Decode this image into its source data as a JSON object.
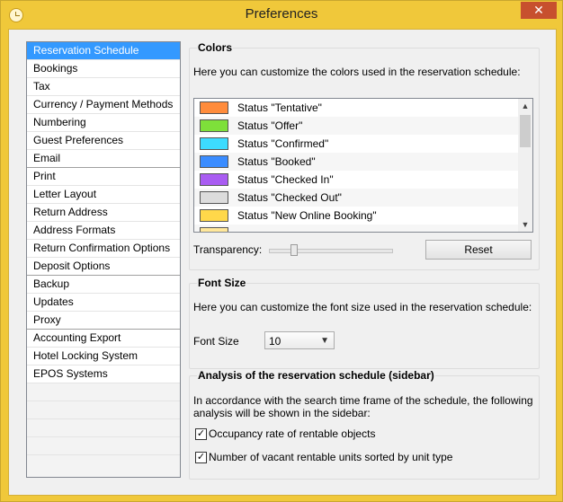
{
  "window": {
    "title": "Preferences",
    "close_symbol": "✕"
  },
  "sidebar": {
    "items": [
      {
        "label": "Reservation Schedule",
        "selected": true,
        "group_end": false
      },
      {
        "label": "Bookings",
        "group_end": false
      },
      {
        "label": "Tax",
        "group_end": false
      },
      {
        "label": "Currency / Payment Methods",
        "group_end": false
      },
      {
        "label": "Numbering",
        "group_end": false
      },
      {
        "label": "Guest Preferences",
        "group_end": false
      },
      {
        "label": "Email",
        "group_end": true
      },
      {
        "label": "Print",
        "group_end": false
      },
      {
        "label": "Letter Layout",
        "group_end": false
      },
      {
        "label": "Return Address",
        "group_end": false
      },
      {
        "label": "Address Formats",
        "group_end": false
      },
      {
        "label": "Return Confirmation Options",
        "group_end": false
      },
      {
        "label": "Deposit Options",
        "group_end": true
      },
      {
        "label": "Backup",
        "group_end": false
      },
      {
        "label": "Updates",
        "group_end": false
      },
      {
        "label": "Proxy",
        "group_end": true
      },
      {
        "label": "Accounting Export",
        "group_end": false
      },
      {
        "label": "Hotel Locking System",
        "group_end": false
      },
      {
        "label": "EPOS Systems",
        "group_end": false
      }
    ]
  },
  "colors": {
    "title": "Colors",
    "description": "Here you can customize the colors used in the reservation schedule:",
    "statuses": [
      {
        "label": "Status \"Tentative\"",
        "color": "#ff8c3c"
      },
      {
        "label": "Status \"Offer\"",
        "color": "#7ee03a"
      },
      {
        "label": "Status \"Confirmed\"",
        "color": "#3ddcff"
      },
      {
        "label": "Status \"Booked\"",
        "color": "#3a8cff"
      },
      {
        "label": "Status \"Checked In\"",
        "color": "#a95cf2"
      },
      {
        "label": "Status \"Checked Out\"",
        "color": "#dcdcdc"
      },
      {
        "label": "Status \"New Online Booking\"",
        "color": "#ffd84a"
      }
    ],
    "transparency_label": "Transparency:",
    "transparency_value": 0.2,
    "reset_label": "Reset"
  },
  "font_size": {
    "title": "Font Size",
    "description": "Here you can customize the font size used in the reservation schedule:",
    "label": "Font Size",
    "value": "10"
  },
  "analysis": {
    "title": "Analysis of the reservation schedule (sidebar)",
    "description_line1": "In accordance with the search time frame of the schedule, the following",
    "description_line2": "analysis will be shown in the sidebar:",
    "options": [
      {
        "label": "Occupancy rate of rentable objects",
        "checked": true
      },
      {
        "label": "Number of vacant rentable units sorted by unit type",
        "checked": true
      }
    ]
  }
}
